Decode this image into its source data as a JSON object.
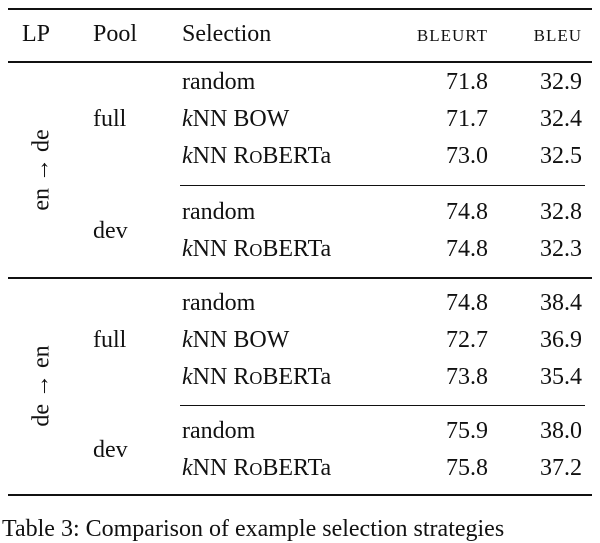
{
  "header": {
    "lp": "LP",
    "pool": "Pool",
    "selection": "Selection",
    "bleurt": "bleurt",
    "bleu": "bleu"
  },
  "groups": [
    {
      "lp": "en → de",
      "pools": [
        {
          "pool": "full",
          "rows": [
            {
              "sel_prefix": "",
              "sel": "random",
              "bleurt": "71.8",
              "bleu": "32.9"
            },
            {
              "sel_prefix": "k",
              "sel": "NN BOW",
              "bleurt": "71.7",
              "bleu": "32.4"
            },
            {
              "sel_prefix": "k",
              "sel": "NN RoBERTa",
              "bleurt": "73.0",
              "bleu": "32.5"
            }
          ]
        },
        {
          "pool": "dev",
          "rows": [
            {
              "sel_prefix": "",
              "sel": "random",
              "bleurt": "74.8",
              "bleu": "32.8"
            },
            {
              "sel_prefix": "k",
              "sel": "NN RoBERTa",
              "bleurt": "74.8",
              "bleu": "32.3"
            }
          ]
        }
      ]
    },
    {
      "lp": "de → en",
      "pools": [
        {
          "pool": "full",
          "rows": [
            {
              "sel_prefix": "",
              "sel": "random",
              "bleurt": "74.8",
              "bleu": "38.4"
            },
            {
              "sel_prefix": "k",
              "sel": "NN BOW",
              "bleurt": "72.7",
              "bleu": "36.9"
            },
            {
              "sel_prefix": "k",
              "sel": "NN RoBERTa",
              "bleurt": "73.8",
              "bleu": "35.4"
            }
          ]
        },
        {
          "pool": "dev",
          "rows": [
            {
              "sel_prefix": "",
              "sel": "random",
              "bleurt": "75.9",
              "bleu": "38.0"
            },
            {
              "sel_prefix": "k",
              "sel": "NN RoBERTa",
              "bleurt": "75.8",
              "bleu": "37.2"
            }
          ]
        }
      ]
    }
  ],
  "caption": "Table 3: Comparison of example selection strategies"
}
